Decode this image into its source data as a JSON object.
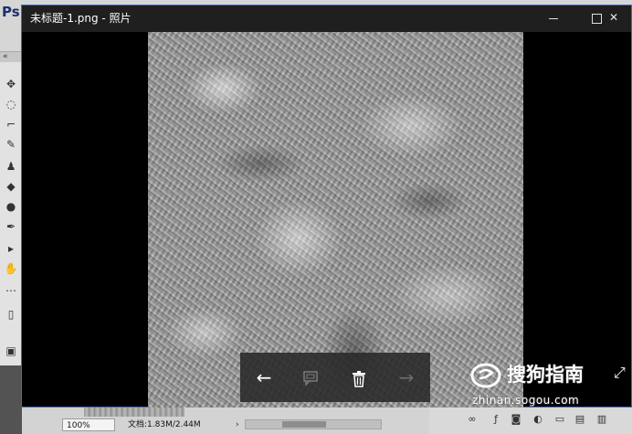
{
  "app": {
    "ps_logo": "Ps"
  },
  "photo_window": {
    "title": "未标题-1.png - 照片"
  },
  "photo_toolbar": {
    "back_glyph": "←",
    "next_glyph": "→"
  },
  "status_bar": {
    "zoom": "100%",
    "doc_size": "文档:1.83M/2.44M"
  },
  "watermark": {
    "brand": "搜狗指南",
    "url": "zhinan.sogou.com"
  },
  "colors": {
    "window_border": "#3b6fb8",
    "title_bar": "#1f1f1f"
  }
}
